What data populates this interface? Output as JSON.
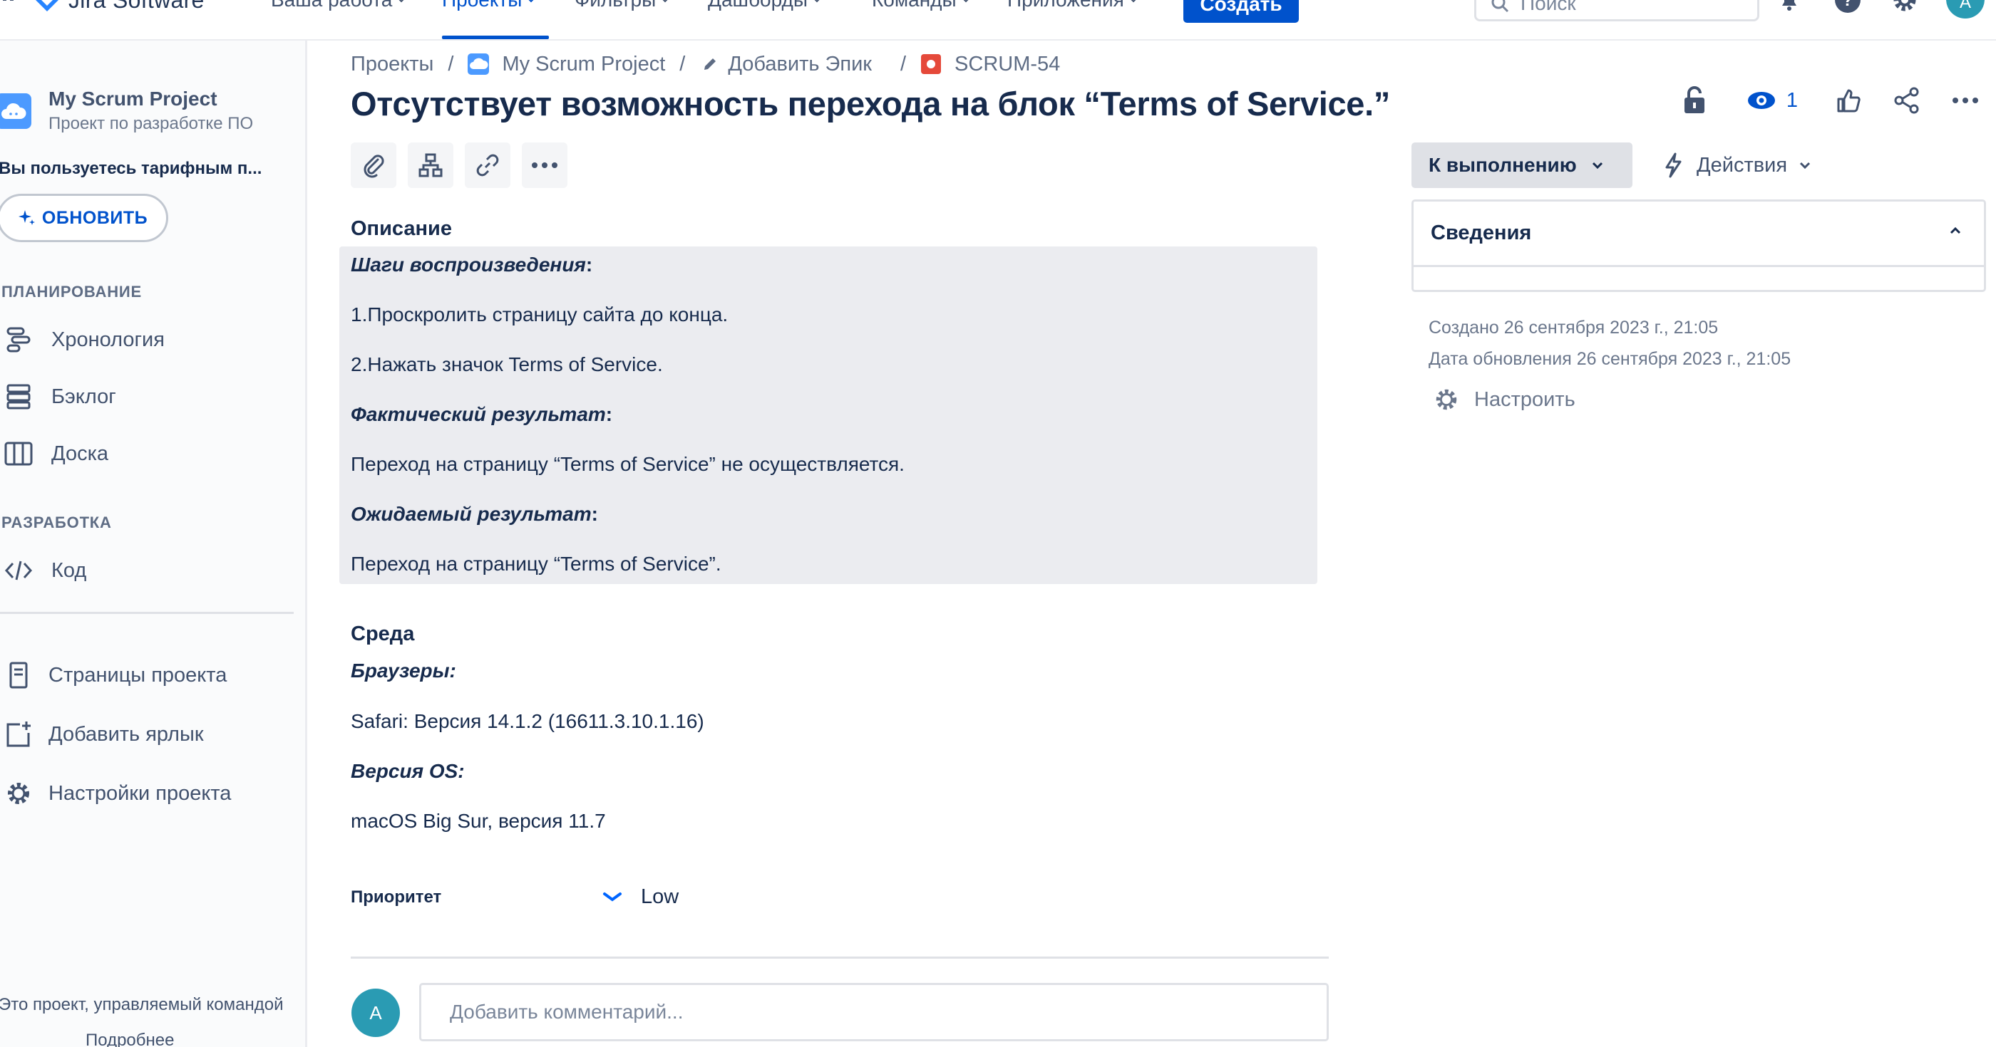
{
  "topnav": {
    "logo_text": "Jira Software",
    "items": [
      {
        "label": "Ваша работа",
        "active": false
      },
      {
        "label": "Проекты",
        "active": true
      },
      {
        "label": "Фильтры",
        "active": false
      },
      {
        "label": "Дашборды",
        "active": false
      },
      {
        "label": "Команды",
        "active": false
      },
      {
        "label": "Приложения",
        "active": false
      }
    ],
    "create_label": "Создать",
    "search_placeholder": "Поиск",
    "avatar_letter": "A",
    "icons": [
      "notifications-icon",
      "help-icon",
      "settings-icon"
    ]
  },
  "sidebar": {
    "project_name": "My Scrum Project",
    "project_sub": "Проект по разработке ПО",
    "plan_note": "Вы пользуетесь тарифным п...",
    "upgrade_label": "ОБНОВИТЬ",
    "planning_heading": "ПЛАНИРОВАНИЕ",
    "planning_items": [
      {
        "label": "Хронология",
        "icon": "timeline-icon"
      },
      {
        "label": "Бэклог",
        "icon": "backlog-icon"
      },
      {
        "label": "Доска",
        "icon": "board-icon"
      }
    ],
    "dev_heading": "РАЗРАБОТКА",
    "dev_items": [
      {
        "label": "Код",
        "icon": "code-icon"
      }
    ],
    "extra_items": [
      {
        "label": "Страницы проекта",
        "icon": "pages-icon"
      },
      {
        "label": "Добавить ярлык",
        "icon": "add-shortcut-icon"
      },
      {
        "label": "Настройки проекта",
        "icon": "settings-icon"
      }
    ],
    "footer_text": "Это проект, управляемый командой",
    "footer_link": "Подробнее"
  },
  "breadcrumb": {
    "projects": "Проекты",
    "project": "My Scrum Project",
    "epic": "Добавить Эпик",
    "issue_key": "SCRUM-54",
    "separator": "/"
  },
  "issue": {
    "title": "Отсутствует возможность перехода на блок “Terms of Service.”",
    "description_label": "Описание",
    "steps_heading": "Шаги воспроизведения",
    "step1": "1.Проскролить страницу сайта до конца.",
    "step2": "2.Нажать значок Terms of Service.",
    "actual_heading": "Фактический результат",
    "actual_text": "Переход на страницу “Terms of Service” не осуществляется.",
    "expected_heading": "Ожидаемый результат",
    "expected_text": "Переход на страницу “Terms of Service”.",
    "colon": ":",
    "environment_label": "Среда",
    "browsers_heading": "Браузеры:",
    "browser_text": "Safari: Версия 14.1.2 (16611.3.10.1.16)",
    "os_heading": "Версия OS:",
    "os_text": "macOS Big Sur, версия 11.7",
    "priority_label": "Приоритет",
    "priority_value": "Low",
    "comment_placeholder": "Добавить комментарий...",
    "comment_avatar": "A"
  },
  "right_panel": {
    "watchers_count": "1",
    "status_label": "К выполнению",
    "actions_label": "Действия",
    "details_label": "Сведения",
    "created": "Создано 26 сентября 2023 г., 21:05",
    "updated": "Дата обновления 26 сентября 2023 г., 21:05",
    "configure_label": "Настроить"
  },
  "colors": {
    "brand": "#0052cc",
    "text": "#172b4d",
    "subtle": "#42526e",
    "desc_bg": "#ebecf0",
    "avatar": "#2a9bb3",
    "issue_type_bug": "#e5493a"
  }
}
